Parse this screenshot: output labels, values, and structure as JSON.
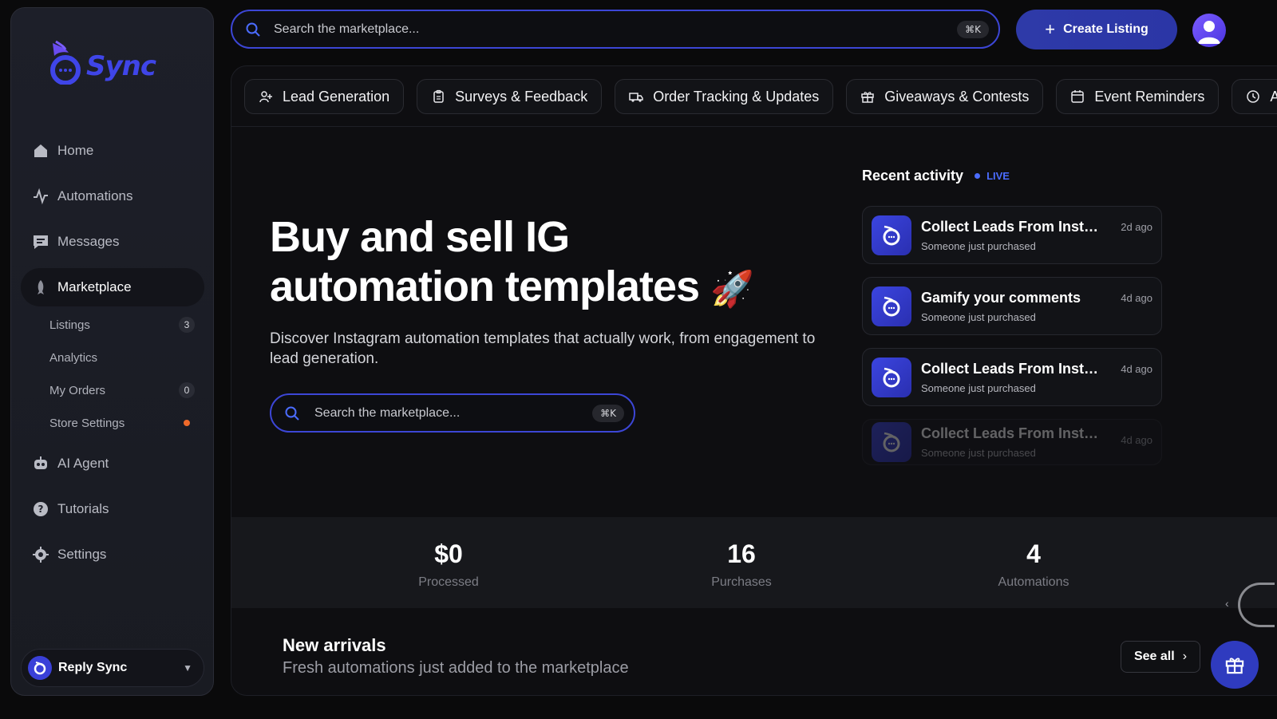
{
  "brand": {
    "name": "Sync"
  },
  "sidebar": {
    "nav": [
      {
        "label": "Home",
        "icon": "home-icon"
      },
      {
        "label": "Automations",
        "icon": "activity-icon"
      },
      {
        "label": "Messages",
        "icon": "message-icon"
      },
      {
        "label": "Marketplace",
        "icon": "rocket-icon",
        "active": true
      },
      {
        "label": "AI Agent",
        "icon": "robot-icon"
      },
      {
        "label": "Tutorials",
        "icon": "help-icon"
      },
      {
        "label": "Settings",
        "icon": "gear-icon"
      }
    ],
    "sub": [
      {
        "label": "Listings",
        "badge": "3"
      },
      {
        "label": "Analytics"
      },
      {
        "label": "My Orders",
        "badge": "0"
      },
      {
        "label": "Store Settings",
        "dot": true
      }
    ],
    "account": {
      "name": "Reply Sync"
    }
  },
  "topbar": {
    "search_placeholder": "Search the marketplace...",
    "shortcut": "⌘K",
    "create_label": "Create Listing"
  },
  "categories": [
    {
      "label": "Lead Generation",
      "icon": "user-plus-icon"
    },
    {
      "label": "Surveys & Feedback",
      "icon": "clipboard-icon"
    },
    {
      "label": "Order Tracking & Updates",
      "icon": "truck-icon"
    },
    {
      "label": "Giveaways & Contests",
      "icon": "gift-icon"
    },
    {
      "label": "Event Reminders",
      "icon": "calendar-icon"
    },
    {
      "label": "App",
      "icon": "clock-icon"
    }
  ],
  "hero": {
    "title_line1": "Buy and sell IG",
    "title_line2": "automation templates",
    "emoji": "🚀",
    "subtitle": "Discover Instagram automation templates that actually work, from engagement to lead generation.",
    "search_placeholder": "Search the marketplace...",
    "shortcut": "⌘K"
  },
  "recent": {
    "title": "Recent activity",
    "live_label": "LIVE",
    "items": [
      {
        "title": "Collect Leads From Instagram",
        "subtitle": "Someone just purchased",
        "time": "2d ago"
      },
      {
        "title": "Gamify your comments",
        "subtitle": "Someone just purchased",
        "time": "4d ago"
      },
      {
        "title": "Collect Leads From Instagram",
        "subtitle": "Someone just purchased",
        "time": "4d ago"
      },
      {
        "title": "Collect Leads From Instagram",
        "subtitle": "Someone just purchased",
        "time": "4d ago"
      }
    ]
  },
  "stats": [
    {
      "value": "$0",
      "label": "Processed"
    },
    {
      "value": "16",
      "label": "Purchases"
    },
    {
      "value": "4",
      "label": "Automations"
    }
  ],
  "new_arrivals": {
    "title": "New arrivals",
    "subtitle": "Fresh automations just added to the marketplace",
    "see_all": "See all"
  },
  "colors": {
    "accent": "#3c46d6",
    "live": "#4b6cff",
    "warning_dot": "#ef6a2a"
  }
}
